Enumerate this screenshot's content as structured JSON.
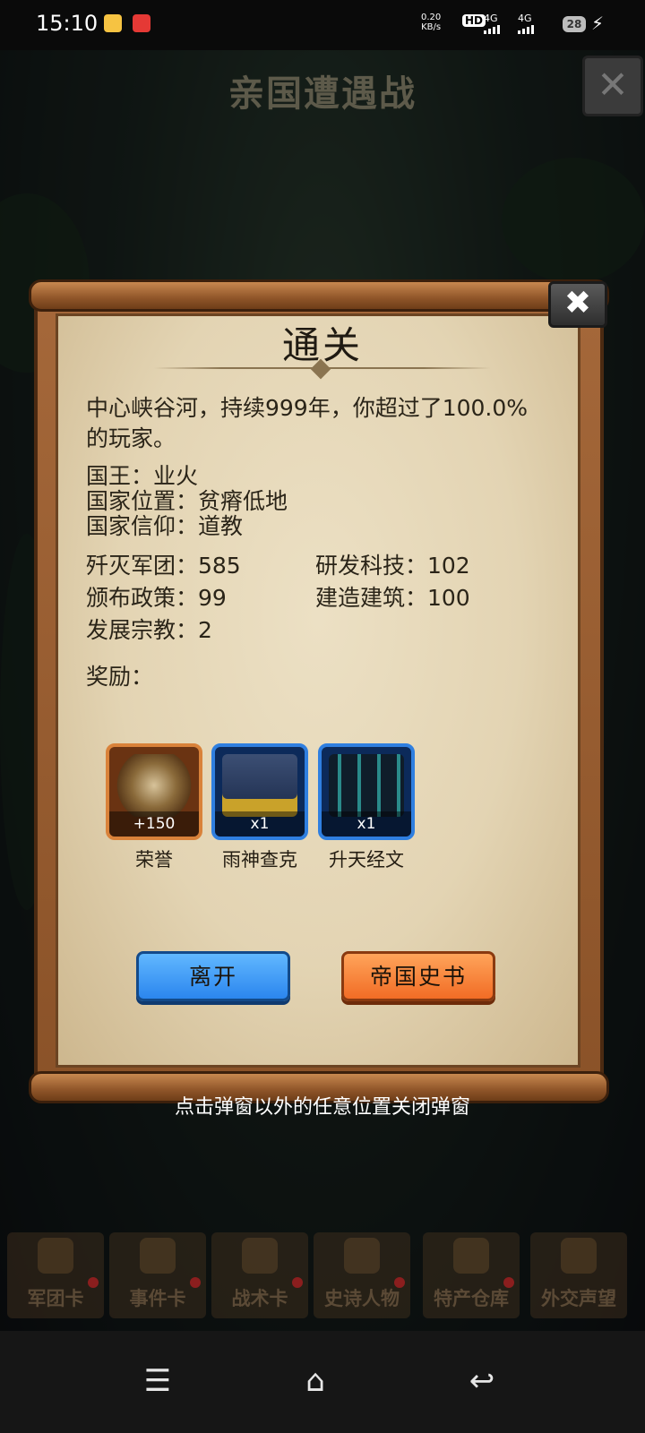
{
  "status_bar": {
    "time": "15:10",
    "net_speed_value": "0.20",
    "net_speed_unit": "KB/s",
    "hd_label": "HD",
    "sim1_label": "4G",
    "sim2_label": "4G",
    "battery_level": "28",
    "charging_icon": "bolt-icon"
  },
  "game": {
    "title": "亲国遭遇战",
    "close_icon": "close-icon",
    "bottom_nav": [
      {
        "label": "军团卡"
      },
      {
        "label": "事件卡"
      },
      {
        "label": "战术卡"
      },
      {
        "label": "史诗人物"
      },
      {
        "label": "特产仓库"
      },
      {
        "label": "外交声望"
      }
    ]
  },
  "dialog": {
    "title": "通关",
    "summary_line1": "中心峡谷河，持续999年，你超过了100.0%",
    "summary_line2": "的玩家。",
    "king": "国王：业火",
    "location": "国家位置：贫瘠低地",
    "faith": "国家信仰：道教",
    "stats": {
      "destroyed_legions": "歼灭军团：585",
      "researched_tech": "研发科技：102",
      "policies": "颁布政策：99",
      "buildings": "建造建筑：100",
      "religions": "发展宗教：2"
    },
    "rewards_label": "奖励：",
    "rewards": [
      {
        "name": "荣誉",
        "quantity": "+150",
        "icon": "honor-emblem-icon"
      },
      {
        "name": "雨神查克",
        "quantity": "x1",
        "icon": "rain-god-chaac-icon"
      },
      {
        "name": "升天经文",
        "quantity": "x1",
        "icon": "ascension-scripture-icon"
      }
    ],
    "leave_button": "离开",
    "history_button": "帝国史书",
    "close_icon": "close-icon",
    "hint": "点击弹窗以外的任意位置关闭弹窗"
  },
  "system_nav": {
    "menu_icon": "menu-icon",
    "home_icon": "home-icon",
    "back_icon": "back-icon"
  },
  "colors": {
    "parchment": "#e3d4b3",
    "scroll_wood": "#a5683a",
    "leave_button": "#2b86ee",
    "history_button": "#f16c25",
    "reward_orange_border": "#d9823a",
    "reward_blue_border": "#2f7fe0"
  }
}
